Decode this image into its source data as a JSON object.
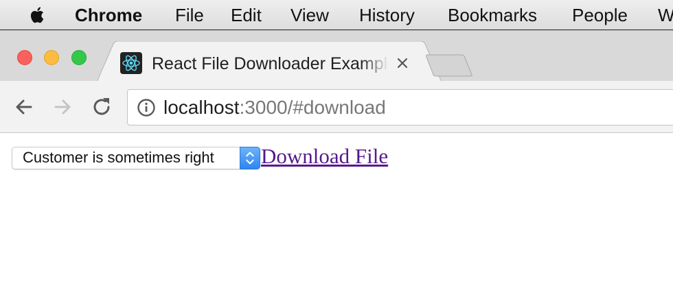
{
  "menubar": {
    "apple_icon": "apple-icon",
    "items": [
      {
        "label": "Chrome",
        "bold": true
      },
      {
        "label": "File"
      },
      {
        "label": "Edit"
      },
      {
        "label": "View"
      },
      {
        "label": "History"
      },
      {
        "label": "Bookmarks"
      },
      {
        "label": "People"
      },
      {
        "label": "W"
      }
    ]
  },
  "window": {
    "traffic_lights": [
      "close",
      "minimize",
      "zoom"
    ]
  },
  "tab": {
    "title": "React File Downloader Example",
    "favicon": "react-logo-icon",
    "close_icon": "close-icon"
  },
  "toolbar": {
    "back_icon": "arrow-left-icon",
    "forward_icon": "arrow-right-icon",
    "reload_icon": "reload-icon",
    "info_icon": "info-icon"
  },
  "address": {
    "host": "localhost",
    "rest": ":3000/#download"
  },
  "page": {
    "select": {
      "selected": "Customer is sometimes right"
    },
    "download_link": "Download File"
  },
  "colors": {
    "link_visited": "#551a8b",
    "select_accent": "#2f86f0",
    "traffic_close": "#fc605c",
    "traffic_min": "#fdbc40",
    "traffic_max": "#34c84a",
    "react_blue": "#61dafb"
  }
}
